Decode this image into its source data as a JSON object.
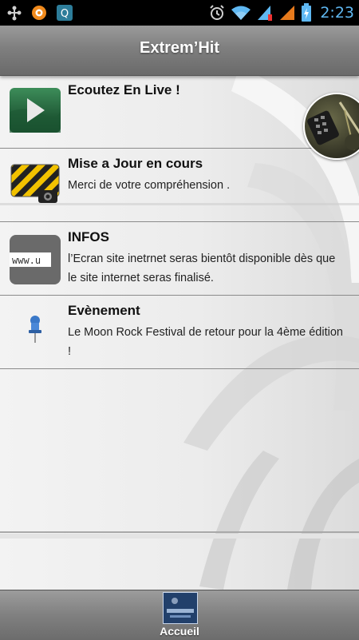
{
  "status_bar": {
    "time": "2:23",
    "left_icons": [
      "usb-icon",
      "avast-icon",
      "quick-q-icon"
    ],
    "right_icons": [
      "alarm-icon",
      "wifi-icon",
      "signal-icon",
      "signal-icon",
      "battery-charging-icon"
    ]
  },
  "header": {
    "title": "Extrem’Hit"
  },
  "list": {
    "items": [
      {
        "title": "Ecoutez En Live !",
        "desc": "",
        "icon": "play-icon"
      },
      {
        "title": "Mise a Jour en cours",
        "desc": "Merci de votre compréhension .",
        "icon": "under-construction-icon"
      },
      {
        "title": "INFOS",
        "desc": "l’Ecran site inetrnet seras bientôt disponible dès que le site internet seras finalisé.",
        "icon": "www-icon"
      },
      {
        "title": "Evènement",
        "desc": "Le Moon Rock Festival de retour pour la 4ème édition !",
        "icon": "pushpin-icon"
      }
    ]
  },
  "bottom_nav": {
    "tabs": [
      {
        "label": "Accueil",
        "icon": "home-tab-icon"
      }
    ]
  },
  "colors": {
    "time_blue": "#5fb8f2",
    "bar_gray": "#808080"
  }
}
